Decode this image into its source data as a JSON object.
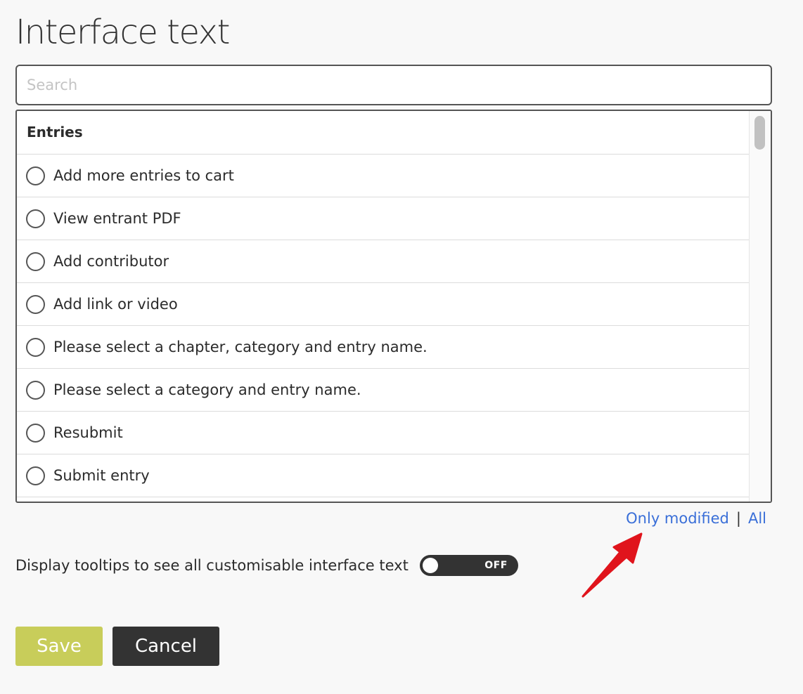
{
  "page": {
    "title": "Interface text"
  },
  "search": {
    "placeholder": "Search",
    "value": ""
  },
  "list": {
    "section_title": "Entries",
    "items": [
      {
        "label": "Add more entries to cart",
        "selected": false
      },
      {
        "label": "View entrant PDF",
        "selected": false
      },
      {
        "label": "Add contributor",
        "selected": false
      },
      {
        "label": "Add link or video",
        "selected": false
      },
      {
        "label": "Please select a chapter, category and entry name.",
        "selected": false
      },
      {
        "label": "Please select a category and entry name.",
        "selected": false
      },
      {
        "label": "Resubmit",
        "selected": false
      },
      {
        "label": "Submit entry",
        "selected": false
      }
    ]
  },
  "filters": {
    "only_modified": "Only modified",
    "separator": "|",
    "all": "All"
  },
  "tooltips": {
    "label": "Display tooltips to see all customisable interface text",
    "toggle_state": "OFF",
    "enabled": false
  },
  "actions": {
    "save_label": "Save",
    "cancel_label": "Cancel"
  },
  "colors": {
    "link": "#3a6fd8",
    "save_button": "#c8cd5a",
    "cancel_button": "#333333",
    "toggle_off": "#333333",
    "annotation_arrow": "#e0141c"
  }
}
